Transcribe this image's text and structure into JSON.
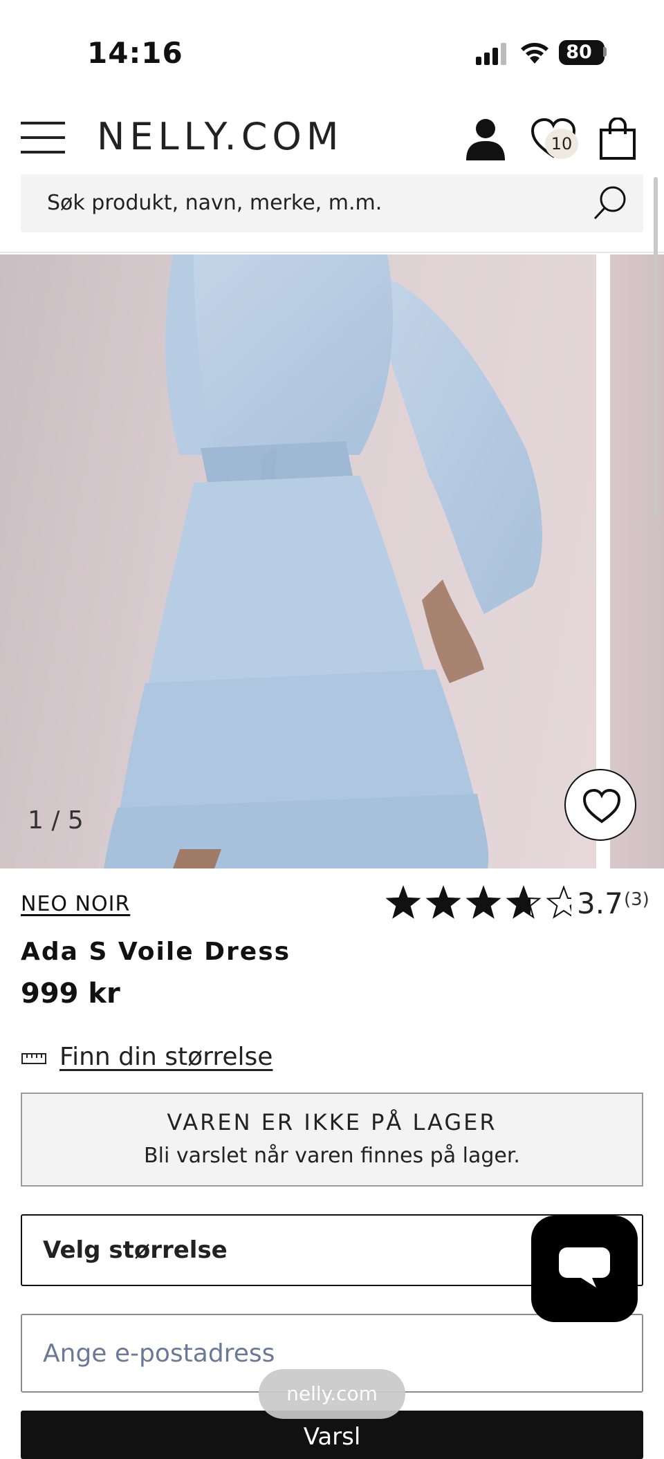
{
  "status_bar": {
    "time": "14:16",
    "battery": "80"
  },
  "header": {
    "brand": "NELLY.COM",
    "wishlist_count": "10"
  },
  "search": {
    "placeholder": "Søk produkt, navn, merke, m.m."
  },
  "gallery": {
    "counter": "1 / 5"
  },
  "product": {
    "brand": "NEO NOIR",
    "name": "Ada S Voile Dress",
    "price": "999 kr",
    "rating": {
      "value": "3.7",
      "count": "(3)",
      "stars_filled": 3.7,
      "stars_max": 5
    }
  },
  "size_guide": {
    "label": "Finn din størrelse"
  },
  "stock": {
    "title": "VAREN ER IKKE PÅ LAGER",
    "subtitle": "Bli varslet når varen finnes på lager."
  },
  "size_select": {
    "label": "Velg størrelse"
  },
  "email": {
    "placeholder": "Ange e-postadress"
  },
  "submit": {
    "label": "Varsl"
  },
  "browser": {
    "url": "nelly.com"
  },
  "icons": [
    "menu-icon",
    "account-icon",
    "heart-icon",
    "bag-icon",
    "search-icon",
    "ruler-icon",
    "chat-icon"
  ]
}
